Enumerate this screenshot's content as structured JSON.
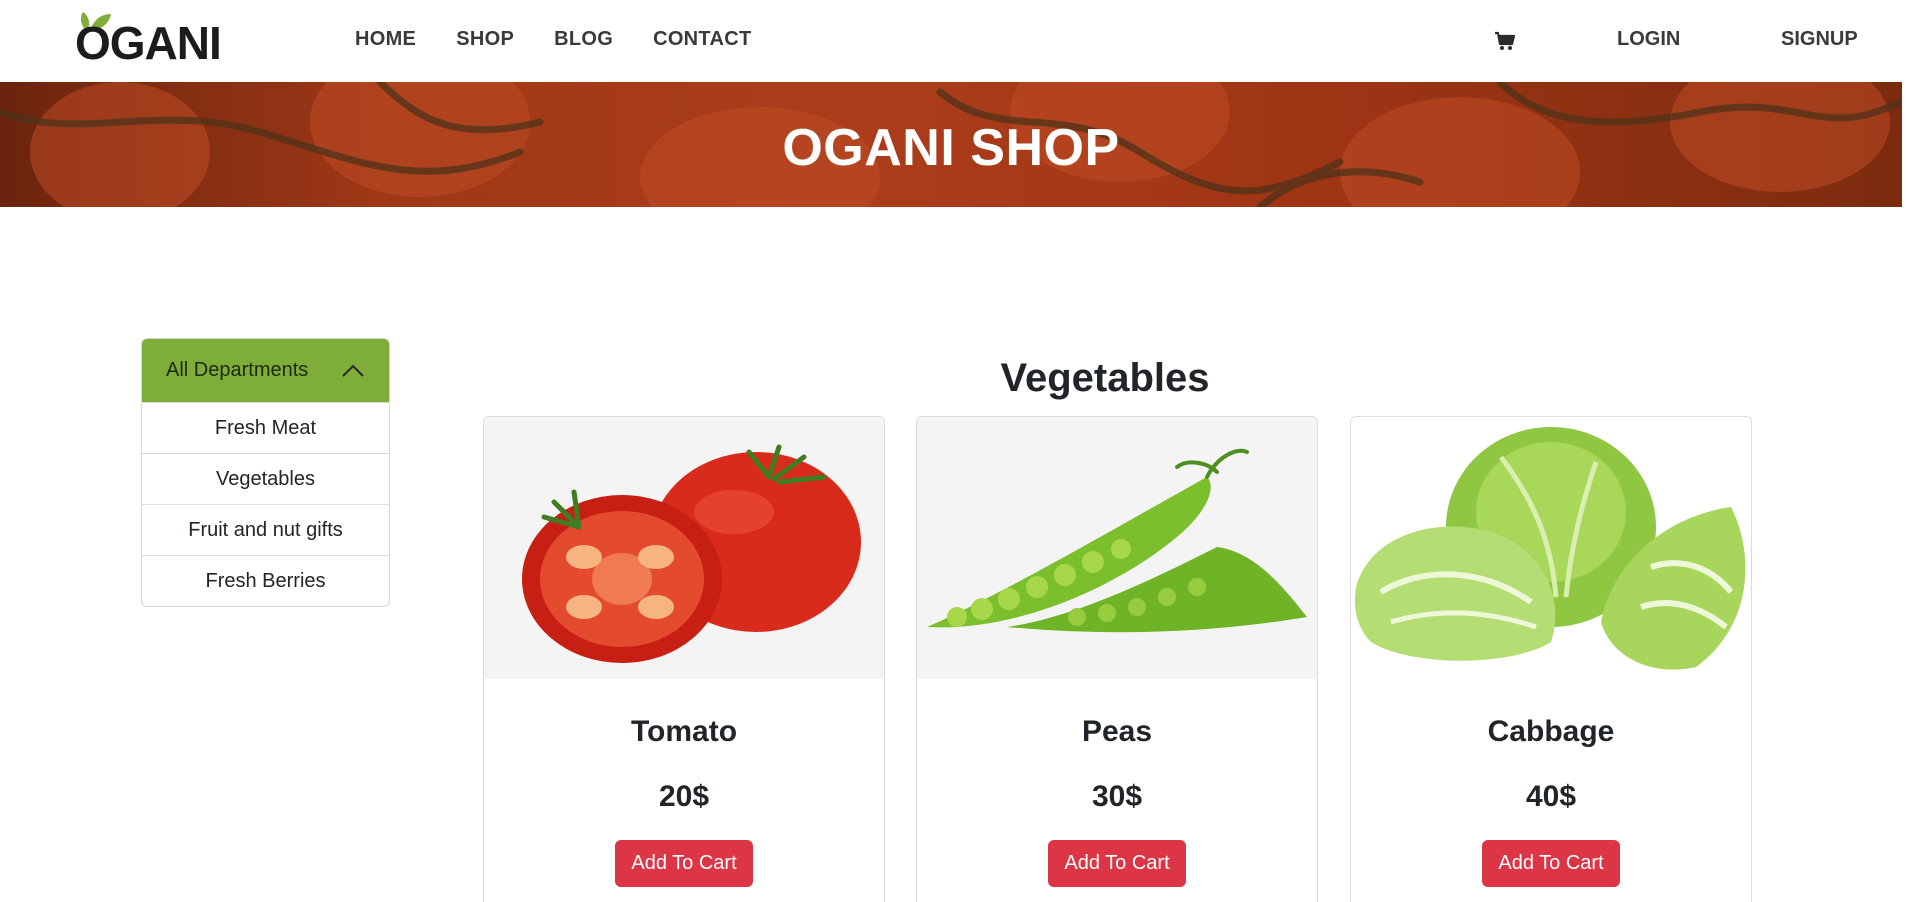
{
  "header": {
    "logo_text": "OGANI",
    "nav": [
      "HOME",
      "SHOP",
      "BLOG",
      "CONTACT"
    ],
    "cart_icon": "cart-icon",
    "login_label": "LOGIN",
    "signup_label": "SIGNUP"
  },
  "banner": {
    "title": "OGANI SHOP"
  },
  "departments": {
    "header_label": "All Departments",
    "toggle_icon": "chevron-up-icon",
    "items": [
      "Fresh Meat",
      "Vegetables",
      "Fruit and nut gifts",
      "Fresh Berries"
    ]
  },
  "section": {
    "title": "Vegetables"
  },
  "products": [
    {
      "name": "Tomato",
      "price": "20$",
      "button": "Add To Cart",
      "image_icon": "tomato-image"
    },
    {
      "name": "Peas",
      "price": "30$",
      "button": "Add To Cart",
      "image_icon": "peas-image"
    },
    {
      "name": "Cabbage",
      "price": "40$",
      "button": "Add To Cart",
      "image_icon": "cabbage-image"
    }
  ],
  "colors": {
    "accent_green": "#7fad39",
    "button_red": "#dc3545",
    "banner_red": "#c4461f"
  }
}
